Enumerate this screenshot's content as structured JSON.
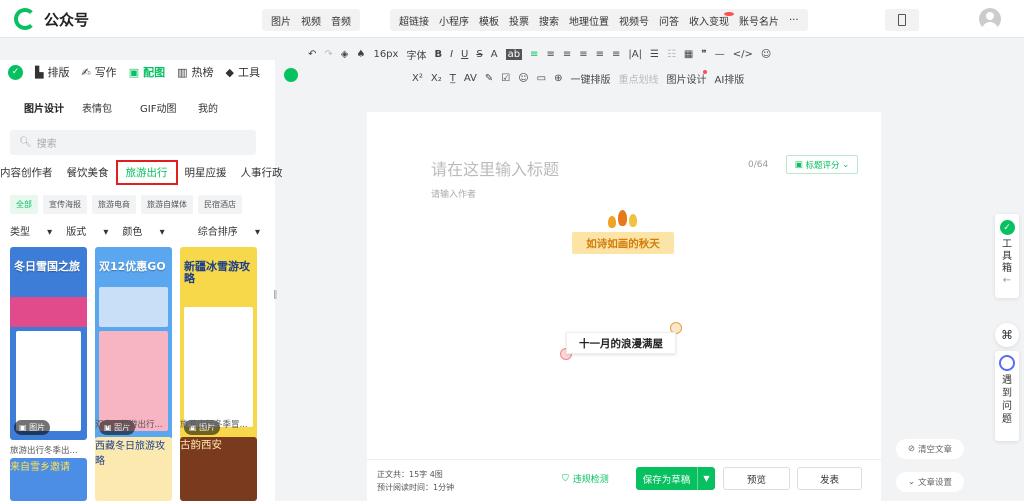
{
  "app": {
    "name": "公众号"
  },
  "menu_left": [
    "图片",
    "视频",
    "音频"
  ],
  "menu_right": [
    "超链接",
    "小程序",
    "模板",
    "投票",
    "搜索",
    "地理位置",
    "视频号",
    "问答",
    "收入变现",
    "账号名片",
    "···"
  ],
  "toolbar_row1": [
    "↶",
    "↷",
    "◈",
    "♠",
    "16px",
    "字体",
    "B",
    "I",
    "U",
    "S",
    "A",
    "ab",
    "≡",
    "≡",
    "≡",
    "≡",
    "≡",
    "≡",
    "|A|",
    "☰",
    "☷",
    "▦",
    "❞",
    "—",
    "</>",
    "☺"
  ],
  "toolbar_row2": [
    "X²",
    "X₂",
    "T̲",
    "AV",
    "✎",
    "☑",
    "☺",
    "▭",
    "⊕",
    "一键排版",
    "重点划线",
    "图片设计",
    "AI排版"
  ],
  "left_tabs": [
    "排版",
    "写作",
    "配图",
    "热榜",
    "工具"
  ],
  "left_active_tab": "配图",
  "sub_tabs": [
    "图片设计",
    "表情包",
    "GIF动图",
    "我的"
  ],
  "search": {
    "placeholder": "搜索"
  },
  "categories": [
    "内容创作者",
    "餐饮美食",
    "旅游出行",
    "明星应援",
    "人事行政"
  ],
  "active_category": "旅游出行",
  "tags": [
    "全部",
    "宣传海报",
    "旅游电商",
    "旅游自媒体",
    "民宿酒店"
  ],
  "filters": {
    "type": "类型",
    "layout": "版式",
    "color": "颜色",
    "sort": "综合排序"
  },
  "cards": [
    {
      "title": "冬日雪国之旅",
      "caption": "旅游出行冬季出...",
      "badge": "图片",
      "bg": "#3d7dd8"
    },
    {
      "title": "双12优惠GO",
      "caption": "双十二旅游出行...",
      "badge": "图片",
      "bg": "#5aa7f0"
    },
    {
      "title": "新疆冰雪游攻略",
      "caption": "旅游出行冬季冒...",
      "badge": "图片",
      "bg": "#f6d84a"
    },
    {
      "title": "来自雪乡邀请",
      "caption": "",
      "badge": "",
      "bg": "#4c8de6"
    },
    {
      "title": "西藏冬日旅游攻略",
      "caption": "",
      "badge": "",
      "bg": "#fbe9b0"
    },
    {
      "title": "古韵西安",
      "caption": "",
      "badge": "",
      "bg": "#7a3a1d"
    }
  ],
  "editor": {
    "title_placeholder": "请在这里输入标题",
    "title_counter": "0/64",
    "score_button": "标题评分",
    "author_placeholder": "请输入作者",
    "autumn_text": "如诗如画的秋天",
    "november_text": "十一月的浪漫满屋"
  },
  "footer": {
    "body_label": "正文共：",
    "body_value": "15字 4图",
    "read_label": "预计阅读时间：",
    "read_value": "1分钟",
    "check": "违规检测",
    "save": "保存为草稿",
    "preview": "预览",
    "publish": "发表"
  },
  "side": {
    "toolbox": [
      "工",
      "具",
      "箱"
    ],
    "help": [
      "遇",
      "到",
      "问",
      "题"
    ],
    "clear": "清空文章",
    "settings": "文章设置"
  }
}
